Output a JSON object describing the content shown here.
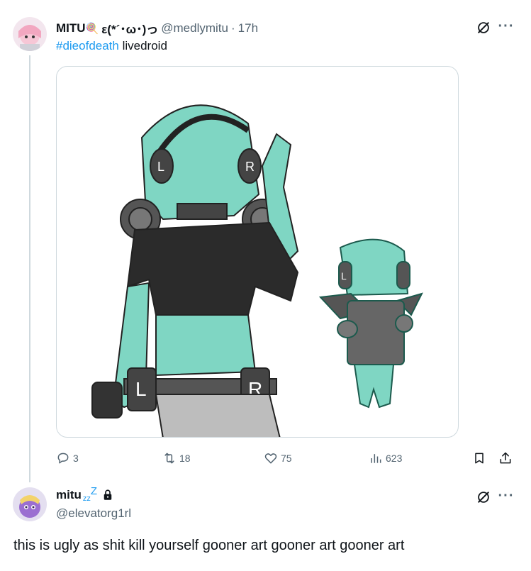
{
  "tweet": {
    "name": "MITU",
    "name_emoji": "🍭",
    "name_kaomoji": "ε(*´･ω･)っ",
    "handle": "@medlymitu",
    "separator": "·",
    "time": "17h",
    "hashtag": "#dieofdeath",
    "text_rest": " livedroid",
    "stats": {
      "replies": "3",
      "retweets": "18",
      "likes": "75",
      "views": "623"
    }
  },
  "reply": {
    "name": "mitu",
    "zzz_small": "zz",
    "zzz_big": "Z",
    "handle": "@elevatorg1rl",
    "text": "this is ugly as shit kill yourself gooner art gooner art gooner art"
  },
  "colors": {
    "accent": "#1d9bf0",
    "muted": "#536471",
    "border": "#cfd9de",
    "drawing_teal": "#7fd6c3"
  },
  "icons": {
    "reply": "reply-icon",
    "retweet": "retweet-icon",
    "like": "heart-icon",
    "views": "views-icon",
    "bookmark": "bookmark-icon",
    "share": "share-icon",
    "grok": "grok-icon",
    "more": "more-icon",
    "lock": "lock-icon"
  }
}
